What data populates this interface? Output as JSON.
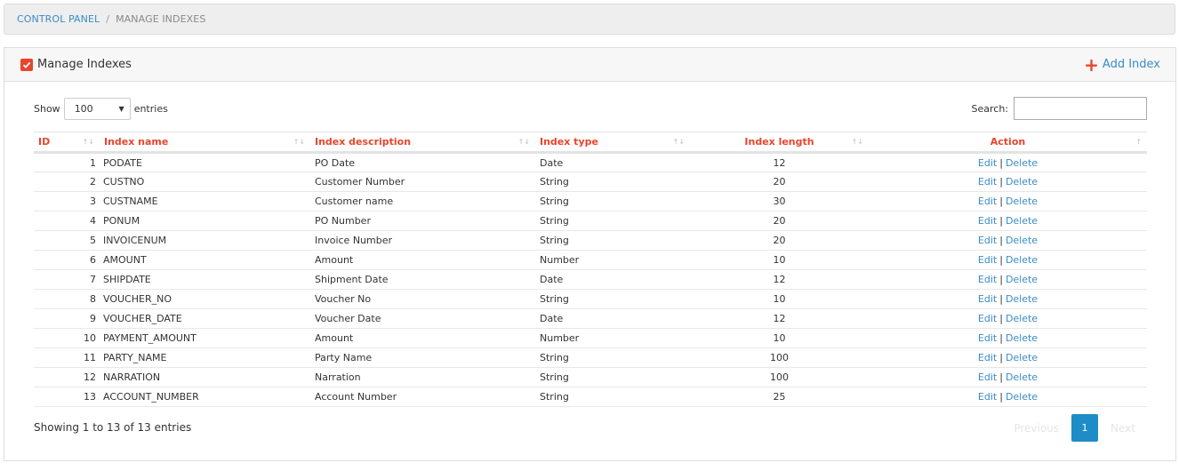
{
  "breadcrumb": {
    "root": "CONTROL PANEL",
    "separator": "/",
    "current": "MANAGE INDEXES"
  },
  "panel": {
    "title": "Manage Indexes",
    "add_label": "Add Index"
  },
  "controls": {
    "show_label": "Show",
    "entries_value": "100",
    "entries_label": "entries",
    "search_label": "Search:"
  },
  "table": {
    "headers": {
      "id": "ID",
      "name": "Index name",
      "description": "Index description",
      "type": "Index type",
      "length": "Index length",
      "action": "Action"
    },
    "edit_label": "Edit",
    "pipe": "|",
    "delete_label": "Delete",
    "rows": [
      {
        "id": "1",
        "name": "PODATE",
        "description": "PO Date",
        "type": "Date",
        "length": "12"
      },
      {
        "id": "2",
        "name": "CUSTNO",
        "description": "Customer Number",
        "type": "String",
        "length": "20"
      },
      {
        "id": "3",
        "name": "CUSTNAME",
        "description": "Customer name",
        "type": "String",
        "length": "30"
      },
      {
        "id": "4",
        "name": "PONUM",
        "description": "PO Number",
        "type": "String",
        "length": "20"
      },
      {
        "id": "5",
        "name": "INVOICENUM",
        "description": "Invoice Number",
        "type": "String",
        "length": "20"
      },
      {
        "id": "6",
        "name": "AMOUNT",
        "description": "Amount",
        "type": "Number",
        "length": "10"
      },
      {
        "id": "7",
        "name": "SHIPDATE",
        "description": "Shipment Date",
        "type": "Date",
        "length": "12"
      },
      {
        "id": "8",
        "name": "VOUCHER_NO",
        "description": "Voucher No",
        "type": "String",
        "length": "10"
      },
      {
        "id": "9",
        "name": "VOUCHER_DATE",
        "description": "Voucher Date",
        "type": "Date",
        "length": "12"
      },
      {
        "id": "10",
        "name": "PAYMENT_AMOUNT",
        "description": "Amount",
        "type": "Number",
        "length": "10"
      },
      {
        "id": "11",
        "name": "PARTY_NAME",
        "description": "Party Name",
        "type": "String",
        "length": "100"
      },
      {
        "id": "12",
        "name": "NARRATION",
        "description": "Narration",
        "type": "String",
        "length": "100"
      },
      {
        "id": "13",
        "name": "ACCOUNT_NUMBER",
        "description": "Account Number",
        "type": "String",
        "length": "25"
      }
    ]
  },
  "footer": {
    "info": "Showing 1 to 13 of 13 entries",
    "previous": "Previous",
    "current_page": "1",
    "next": "Next"
  },
  "colors": {
    "accent": "#e8452c",
    "link": "#3a8cc9",
    "pager_active": "#1e8cc7"
  }
}
